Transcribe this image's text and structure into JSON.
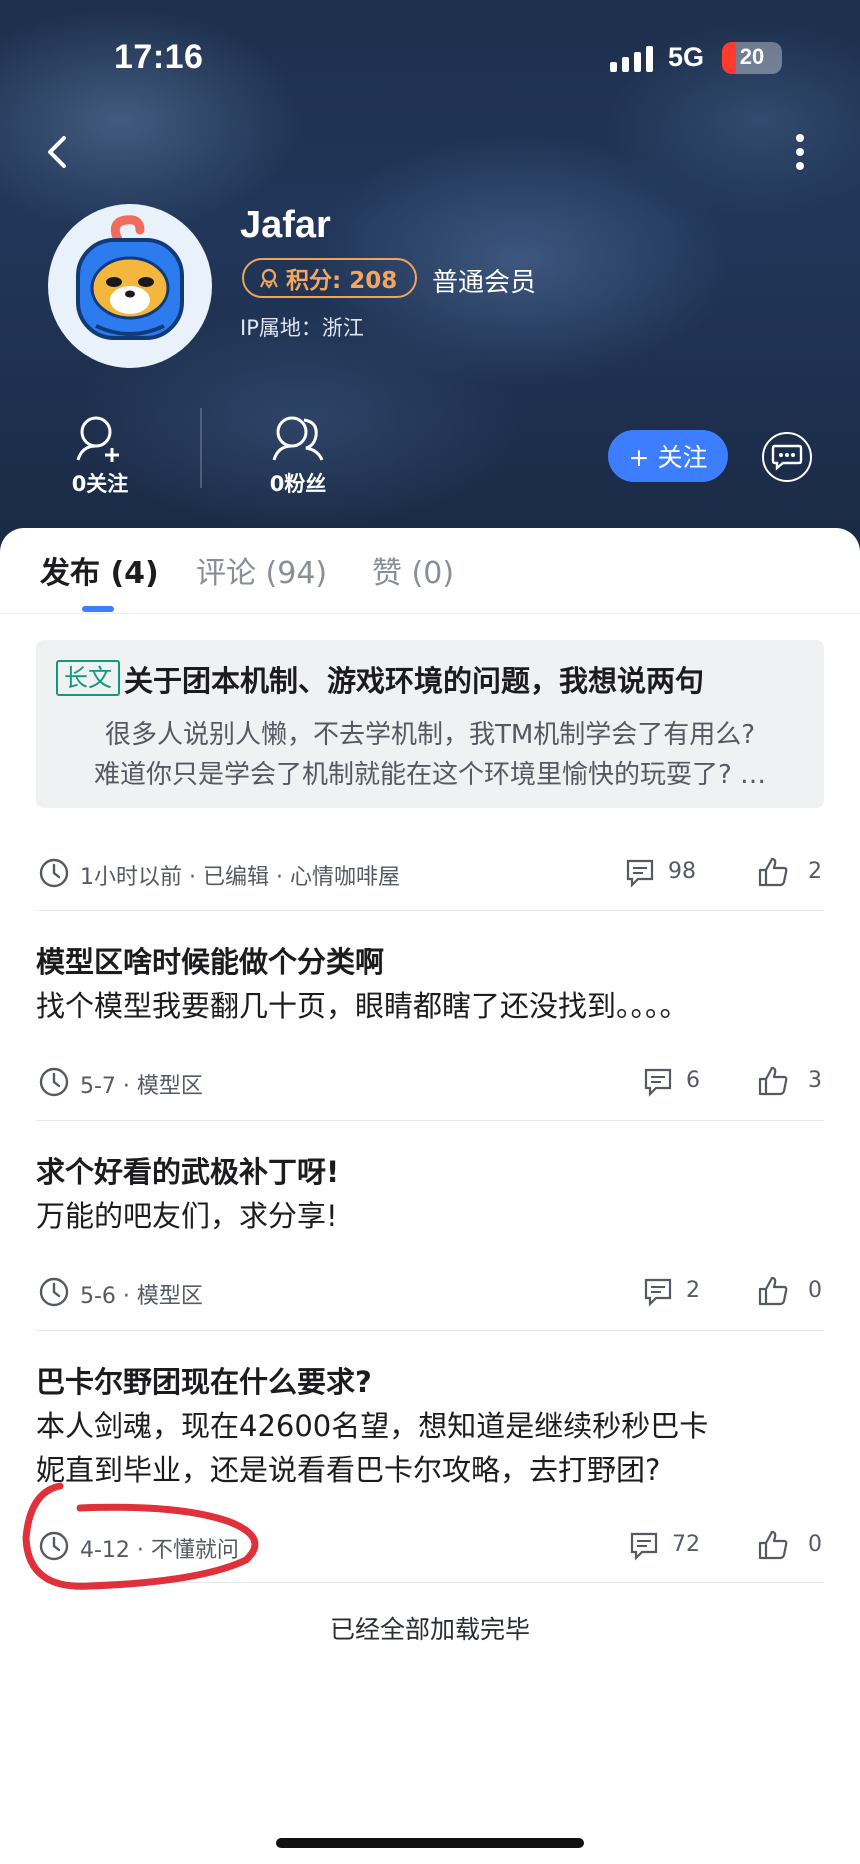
{
  "status_bar": {
    "time": "17:16",
    "network": "5G",
    "battery": "20"
  },
  "profile": {
    "name": "Jafar",
    "points_label": "积分: 208",
    "member_level": "普通会员",
    "ip_location": "IP属地：浙江",
    "following_label": "0关注",
    "followers_label": "0粉丝",
    "follow_button": "+ 关注"
  },
  "tabs": [
    {
      "label": "发布 (4)",
      "active": true
    },
    {
      "label": "评论 (94)",
      "active": false
    },
    {
      "label": "赞 (0)",
      "active": false
    }
  ],
  "featured": {
    "tag": "长文",
    "title": "关于团本机制、游戏环境的问题，我想说两句",
    "lines": [
      "很多人说别人懒，不去学机制，我TM机制学会了有用么?",
      "难道你只是学会了机制就能在这个环境里愉快的玩耍了? …"
    ],
    "meta": "1小时以前 · 已编辑 · 心情咖啡屋",
    "comments": "98",
    "likes": "2"
  },
  "posts": [
    {
      "title": "模型区啥时候能做个分类啊",
      "body": [
        "找个模型我要翻几十页，眼睛都瞎了还没找到。。。。"
      ],
      "meta": "5-7 · 模型区",
      "comments": "6",
      "likes": "3"
    },
    {
      "title": "求个好看的武极补丁呀!",
      "body": [
        "万能的吧友们，求分享!"
      ],
      "meta": "5-6 · 模型区",
      "comments": "2",
      "likes": "0"
    },
    {
      "title": "巴卡尔野团现在什么要求?",
      "body": [
        "本人剑魂，现在42600名望，想知道是继续秒秒巴卡",
        "妮直到毕业，还是说看看巴卡尔攻略，去打野团?"
      ],
      "meta": "4-12 · 不懂就问",
      "comments": "72",
      "likes": "0"
    }
  ],
  "footer": {
    "loaded_text": "已经全部加载完毕"
  },
  "colors": {
    "accent": "#3d7dff",
    "points": "#f4a65c",
    "long_tag": "#0f9a7c",
    "annotation": "#e0303a"
  }
}
